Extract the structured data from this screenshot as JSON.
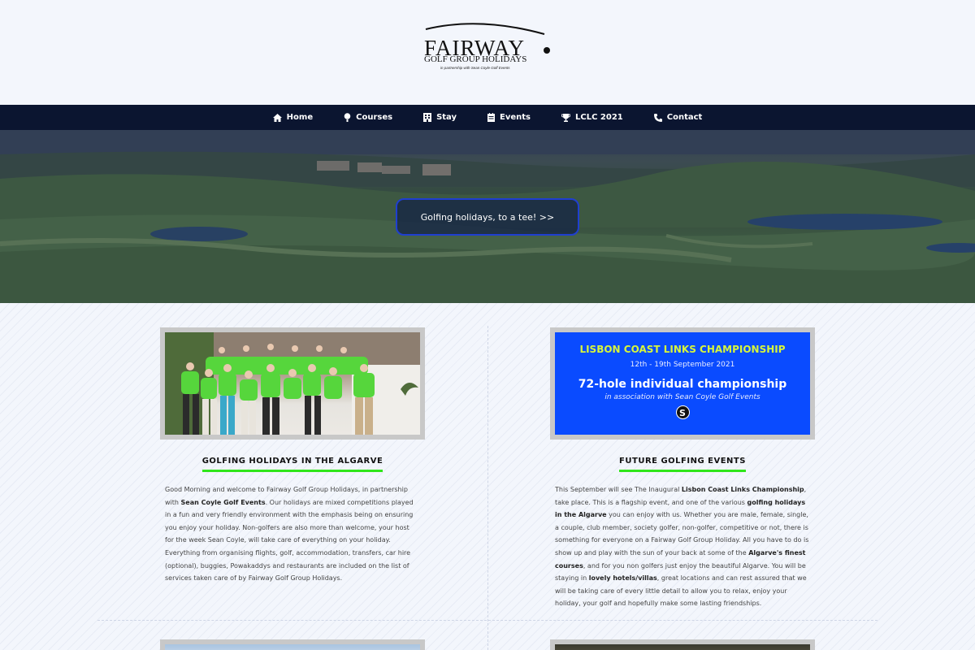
{
  "logo": {
    "word": "FAIRWAY",
    "subtitle": "GOLF GROUP HOLIDAYS",
    "tagline": "in partnership with Sean Coyle Golf Events"
  },
  "nav": {
    "items": [
      {
        "label": "Home",
        "icon": "home-icon"
      },
      {
        "label": "Courses",
        "icon": "golf-ball-icon"
      },
      {
        "label": "Stay",
        "icon": "building-icon"
      },
      {
        "label": "Events",
        "icon": "calendar-icon"
      },
      {
        "label": "LCLC 2021",
        "icon": "trophy-icon"
      },
      {
        "label": "Contact",
        "icon": "phone-icon"
      }
    ]
  },
  "hero": {
    "button_label": "Golfing holidays, to a tee!  >>"
  },
  "left": {
    "heading": "GOLFING HOLIDAYS IN THE ALGARVE",
    "t1": "Good Morning and welcome to Fairway Golf Group Holidays, in partnership with ",
    "b1": "Sean Coyle Golf Events",
    "t2": ". Our holidays are mixed competitions played in a fun and very friendly environment with the emphasis being on ensuring you enjoy your holiday. Non-golfers are also more than welcome, your host for the week Sean Coyle, will take care of everything on your holiday. Everything from organising flights, golf, accommodation, transfers, car hire (optional), buggies, Powakaddys and restaurants are included on the list of services taken care of by Fairway Golf Group Holidays."
  },
  "right": {
    "promo": {
      "title": "LISBON COAST LINKS CHAMPIONSHIP",
      "dates": "12th - 19th September 2021",
      "headline": "72-hole individual championship",
      "assoc": "in association with Sean Coyle Golf Events",
      "badge": "S"
    },
    "heading": "FUTURE GOLFING EVENTS",
    "t1": "This September will see The Inaugural ",
    "b1": "Lisbon Coast Links Championship",
    "t2": ", take place. This is a flagship event, and one of the various ",
    "b2": "golfing holidays in the Algarve",
    "t3": " you can enjoy with us. Whether you are male, female, single, a couple, club member, society golfer, non-golfer, competitive or not, there is something for everyone on a Fairway Golf Group Holiday. All you have to do is show up and play with the sun of your back at some of the ",
    "b3": "Algarve's finest courses",
    "t4": ", and for you non golfers just enjoy the beautiful Algarve. You will be staying in ",
    "b4": "lovely hotels/villas",
    "t5": ", great locations and can rest assured that we will be taking care of every little detail to allow you to relax, enjoy your holiday, your golf and hopefully make some lasting friendships."
  },
  "colors": {
    "nav_bg": "#0b1530",
    "promo_bg": "#0a4bff",
    "promo_title": "#d6f53b",
    "heading_underline": "#30e61b",
    "hero_button_border": "#1f3fd0"
  }
}
